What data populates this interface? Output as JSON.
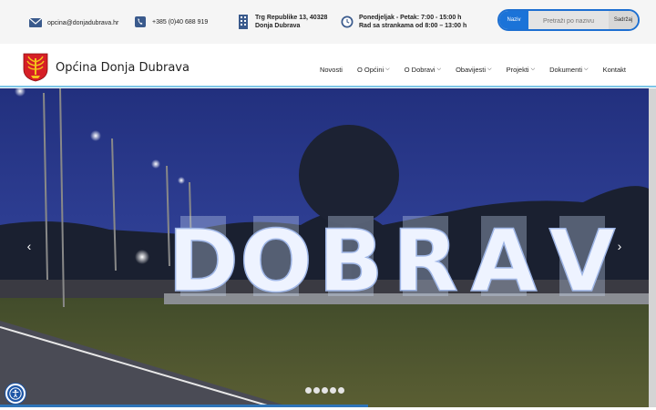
{
  "contact": {
    "email": "opcina@donjadubrava.hr",
    "phone": "+385 (0)40 688 919",
    "address_line1": "Trg Republike 13, 40328",
    "address_line2": "Donja Dubrava",
    "hours_line1": "Ponedjeljak - Petak: 7:00 - 15:00 h",
    "hours_line2": "Rad sa strankama od 8:00 – 13:00 h"
  },
  "search": {
    "left_label": "Naziv",
    "placeholder": "Pretraži po nazivu",
    "right_label": "Sadržaj"
  },
  "site": {
    "title": "Općina Donja Dubrava"
  },
  "nav": {
    "items": [
      {
        "label": "Novosti"
      },
      {
        "label": "O Općini"
      },
      {
        "label": "O Dobravi"
      },
      {
        "label": "Obavijesti"
      },
      {
        "label": "Projekti"
      },
      {
        "label": "Dokumenti"
      },
      {
        "label": "Kontakt"
      }
    ]
  },
  "hero": {
    "letters": [
      "D",
      "O",
      "B",
      "R",
      "A",
      "V"
    ],
    "arrow_left": "‹",
    "arrow_right": "›",
    "slide_count": 5
  },
  "colors": {
    "accent": "#1b73d8",
    "header_border": "#7ec6e8",
    "sky": "#2a3a88",
    "accessibility": "#1c55a6"
  },
  "icons": {
    "email": "envelope-icon",
    "phone": "phone-icon",
    "address": "building-icon",
    "hours": "clock-icon",
    "accessibility": "accessibility-icon"
  }
}
